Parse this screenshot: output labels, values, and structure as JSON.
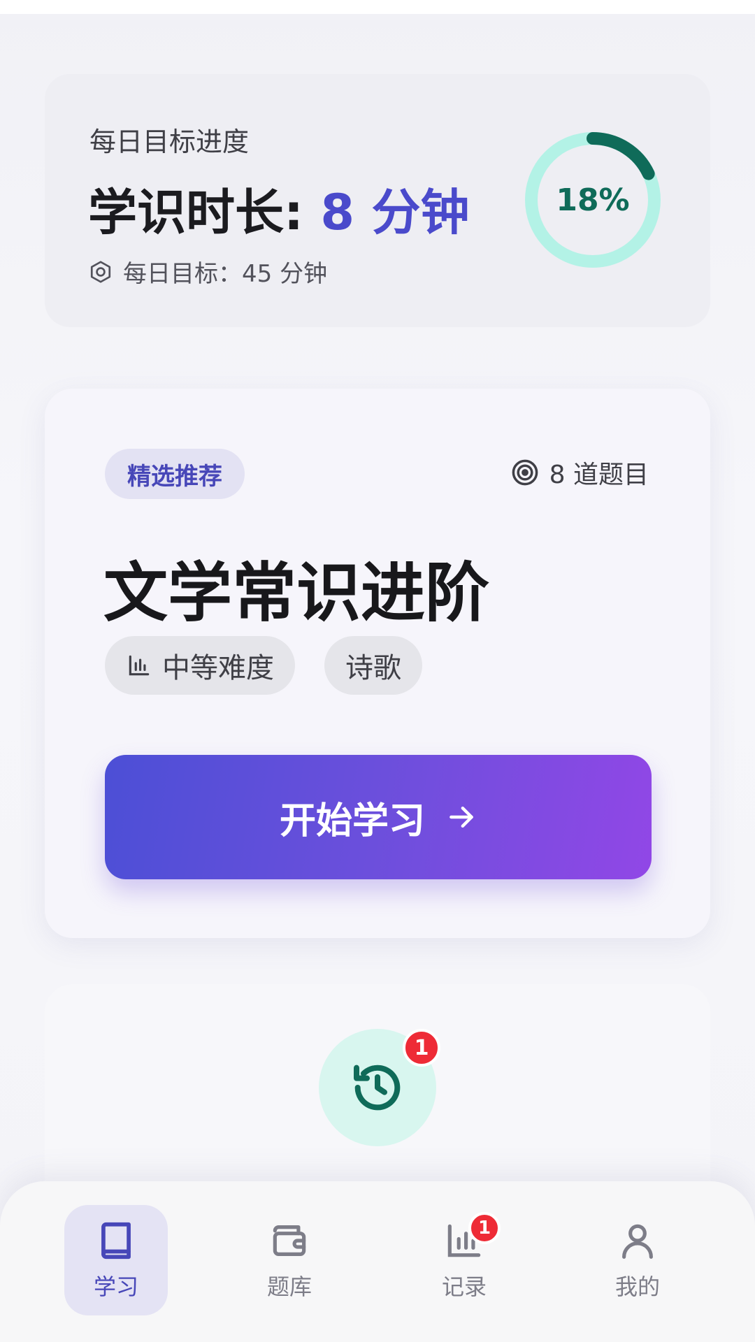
{
  "goal": {
    "label": "每日目标进度",
    "main_prefix": "学识时长: ",
    "main_value": "8 分钟",
    "daily_target": "每日目标：45 分钟",
    "progress_text": "18%",
    "progress_fraction": 0.18,
    "ring_color": "#0f6b59",
    "ring_track_color": "#b3f2e6"
  },
  "recommend": {
    "badge": "精选推荐",
    "question_count": "8 道题目",
    "title": "文学常识进阶",
    "difficulty": "中等难度",
    "tag": "诗歌",
    "start_button": "开始学习",
    "button_gradient": [
      "#4c4fd6",
      "#9147e6"
    ]
  },
  "history": {
    "icon": "history-icon",
    "badge_count": "1"
  },
  "bottom_nav": {
    "items": [
      {
        "label": "学习",
        "icon": "book-icon",
        "active": true
      },
      {
        "label": "题库",
        "icon": "wallet-icon",
        "active": false
      },
      {
        "label": "记录",
        "icon": "bar-chart-icon",
        "active": false,
        "badge": "1"
      },
      {
        "label": "我的",
        "icon": "user-icon",
        "active": false
      }
    ]
  },
  "colors": {
    "accent": "#4a4acb",
    "badge_red": "#ee2b36",
    "teal": "#0f6b59"
  }
}
